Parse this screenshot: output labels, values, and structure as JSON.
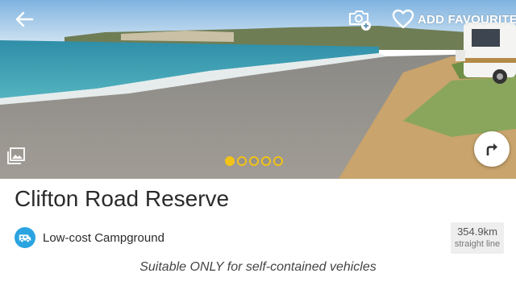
{
  "header": {
    "back_icon": "arrow-left-icon",
    "camera_icon": "add-photo-icon",
    "favourite_icon": "heart-outline-icon",
    "favourite_label": "ADD FAVOURITE"
  },
  "gallery": {
    "gallery_icon": "image-gallery-icon",
    "total_photos": 5,
    "active_index": 0,
    "dot_color": "#f3c318"
  },
  "directions": {
    "icon": "directions-turn-icon"
  },
  "place": {
    "name": "Clifton Road Reserve",
    "type_icon": "campervan-icon",
    "type_icon_color": "#2aa4e0",
    "type_label": "Low-cost Campground",
    "distance_value": "354.9km",
    "distance_unit": "straight line",
    "note": "Suitable ONLY for self-contained vehicles"
  }
}
